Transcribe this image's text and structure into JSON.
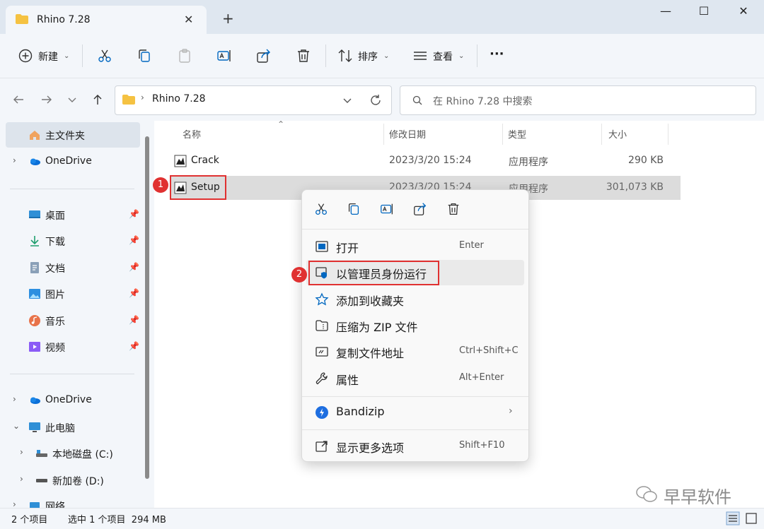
{
  "window": {
    "tab_title": "Rhino 7.28",
    "tab_close": "✕",
    "new_tab": "+",
    "minimize": "—",
    "maximize": "☐",
    "close": "✕"
  },
  "toolbar": {
    "new_label": "新建",
    "sort_label": "排序",
    "view_label": "查看",
    "more": "···"
  },
  "address": {
    "breadcrumb": "Rhino 7.28",
    "search_placeholder": "在 Rhino 7.28 中搜索"
  },
  "sidebar": {
    "home": "主文件夹",
    "onedrive": "OneDrive",
    "quick": [
      {
        "label": "桌面"
      },
      {
        "label": "下载"
      },
      {
        "label": "文档"
      },
      {
        "label": "图片"
      },
      {
        "label": "音乐"
      },
      {
        "label": "视频"
      }
    ],
    "onedrive2": "OneDrive",
    "thispc": "此电脑",
    "drive_c": "本地磁盘 (C:)",
    "drive_d": "新加卷 (D:)",
    "network": "网络"
  },
  "columns": {
    "name": "名称",
    "modified": "修改日期",
    "type": "类型",
    "size": "大小"
  },
  "files": [
    {
      "name": "Crack",
      "modified": "2023/3/20 15:24",
      "type": "应用程序",
      "size": "290 KB"
    },
    {
      "name": "Setup",
      "modified": "2023/3/20 15:24",
      "type": "应用程序",
      "size": "301,073 KB"
    }
  ],
  "context_menu": {
    "open": "打开",
    "open_sc": "Enter",
    "run_admin": "以管理员身份运行",
    "add_fav": "添加到收藏夹",
    "zip": "压缩为 ZIP 文件",
    "copy_path": "复制文件地址",
    "copy_path_sc": "Ctrl+Shift+C",
    "properties": "属性",
    "properties_sc": "Alt+Enter",
    "bandizip": "Bandizip",
    "more_options": "显示更多选项",
    "more_options_sc": "Shift+F10"
  },
  "markers": {
    "one": "1",
    "two": "2"
  },
  "status": {
    "count": "2 个项目",
    "selected": "选中 1 个项目  294 MB"
  },
  "watermark": "早早软件",
  "colors": {
    "accent": "#0067c0",
    "highlight_red": "#e03131",
    "selection": "#dcdcdc"
  }
}
